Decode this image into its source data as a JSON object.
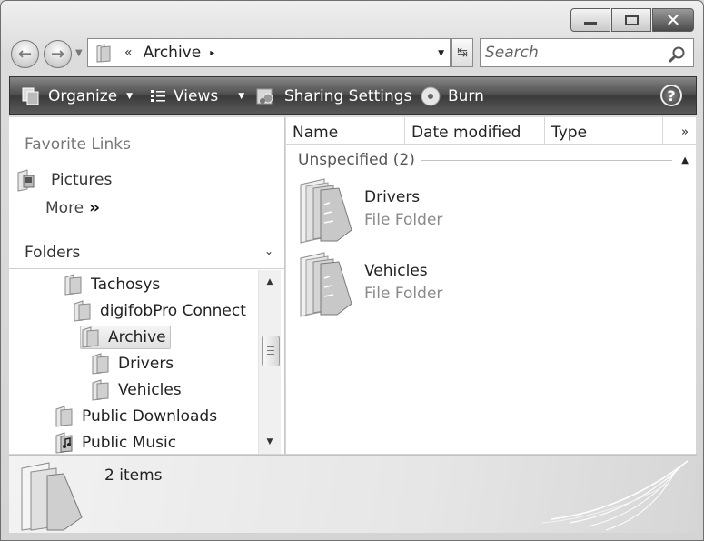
{
  "window": {
    "buttons": {
      "minimize": "minimize",
      "maximize": "maximize",
      "close": "✕"
    }
  },
  "address": {
    "root_separator": "«",
    "crumb": "Archive",
    "crumb_separator": "▸"
  },
  "search": {
    "placeholder": "Search"
  },
  "toolbar": {
    "organize": "Organize",
    "views": "Views",
    "sharing": "Sharing Settings",
    "burn": "Burn",
    "help": "?"
  },
  "left_pane": {
    "favorites_heading": "Favorite Links",
    "favorites": [
      {
        "label": "Pictures",
        "icon": "pictures-folder-icon"
      }
    ],
    "more_label": "More",
    "more_glyph": "››",
    "folders_heading": "Folders",
    "tree": [
      {
        "label": "Tachosys",
        "icon": "folder-icon",
        "selected": false
      },
      {
        "label": "digifobPro Connect",
        "icon": "folder-icon",
        "selected": false
      },
      {
        "label": "Archive",
        "icon": "folder-icon",
        "selected": true
      },
      {
        "label": "Drivers",
        "icon": "folder-icon",
        "selected": false
      },
      {
        "label": "Vehicles",
        "icon": "folder-icon",
        "selected": false
      },
      {
        "label": "Public Downloads",
        "icon": "folder-icon",
        "selected": false
      },
      {
        "label": "Public Music",
        "icon": "music-folder-icon",
        "selected": false
      }
    ]
  },
  "columns": {
    "name": "Name",
    "date": "Date modified",
    "type": "Type",
    "more": "»"
  },
  "group": {
    "label": "Unspecified (2)"
  },
  "items": [
    {
      "name": "Drivers",
      "type": "File Folder"
    },
    {
      "name": "Vehicles",
      "type": "File Folder"
    }
  ],
  "details": {
    "count": "2 items"
  },
  "colors": {
    "toolbar": "#4a4a4a",
    "selection": "#e8e8e8",
    "muted_text": "#8a8a8a"
  }
}
